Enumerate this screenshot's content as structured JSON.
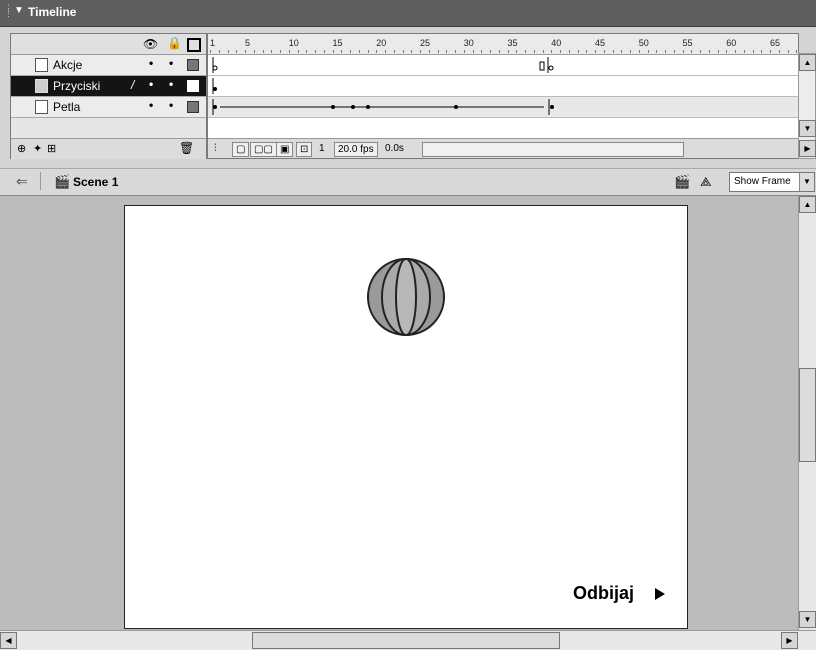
{
  "timeline": {
    "title": "Timeline",
    "layers": [
      {
        "name": "Akcje",
        "selected": false
      },
      {
        "name": "Przyciski",
        "selected": true
      },
      {
        "name": "Petla",
        "selected": false
      }
    ],
    "ruler_ticks": [
      "1",
      "5",
      "10",
      "15",
      "20",
      "25",
      "30",
      "35",
      "40",
      "45",
      "50",
      "55",
      "60",
      "65"
    ],
    "current_frame": "1",
    "fps": "20.0 fps",
    "time": "0.0s"
  },
  "scene_bar": {
    "scene_name": "Scene 1",
    "zoom_select": "Show Frame"
  },
  "stage": {
    "button_label": "Odbijaj",
    "ball_colors": {
      "outer": "#9a9a9a",
      "inner": "#b8b8b8",
      "stroke": "#222222"
    }
  },
  "icons": {
    "eye": "eye-icon",
    "lock": "lock-icon",
    "outline": "outline-icon",
    "layer": "layer-icon",
    "pencil": "pencil-icon",
    "trash": "trash-icon",
    "back": "back-arrow-icon",
    "scene": "scene-icon"
  }
}
